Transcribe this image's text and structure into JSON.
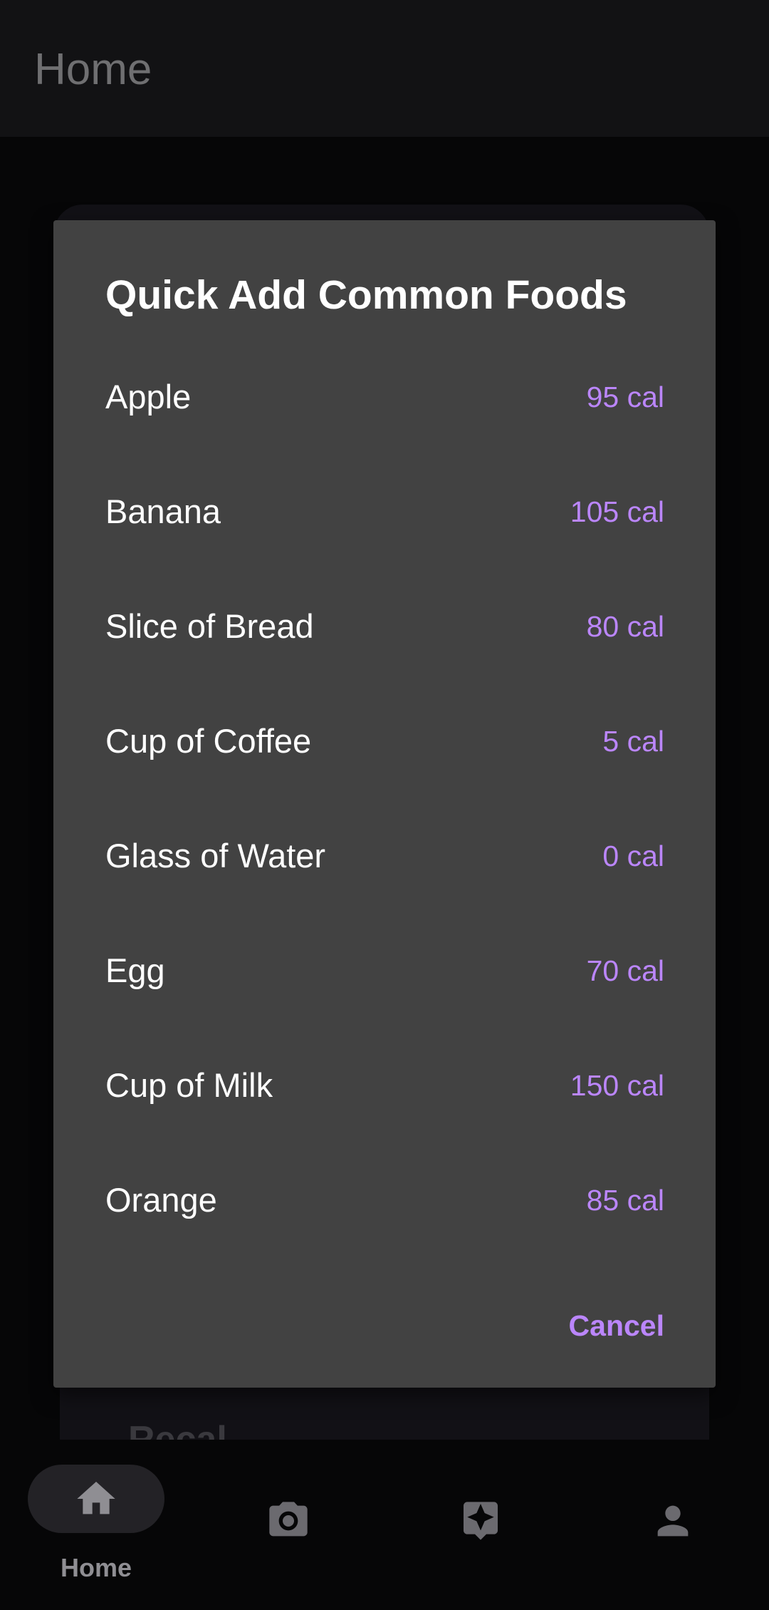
{
  "app_bar": {
    "title": "Home"
  },
  "background": {
    "partial_card_text": "Recal"
  },
  "dialog": {
    "title": "Quick Add Common Foods",
    "items": [
      {
        "name": "Apple",
        "calories": "95 cal"
      },
      {
        "name": "Banana",
        "calories": "105 cal"
      },
      {
        "name": "Slice of Bread",
        "calories": "80 cal"
      },
      {
        "name": "Cup of Coffee",
        "calories": "5 cal"
      },
      {
        "name": "Glass of Water",
        "calories": "0 cal"
      },
      {
        "name": "Egg",
        "calories": "70 cal"
      },
      {
        "name": "Cup of Milk",
        "calories": "150 cal"
      },
      {
        "name": "Orange",
        "calories": "85 cal"
      }
    ],
    "cancel_label": "Cancel"
  },
  "bottom_nav": {
    "items": [
      {
        "label": "Home",
        "icon": "home-icon",
        "selected": true
      },
      {
        "label": "",
        "icon": "camera-icon",
        "selected": false
      },
      {
        "label": "",
        "icon": "sparkle-icon",
        "selected": false
      },
      {
        "label": "",
        "icon": "person-icon",
        "selected": false
      }
    ]
  },
  "colors": {
    "accent": "#bb86fc",
    "dialog_surface": "#424242",
    "scrim_background": "#060607"
  }
}
